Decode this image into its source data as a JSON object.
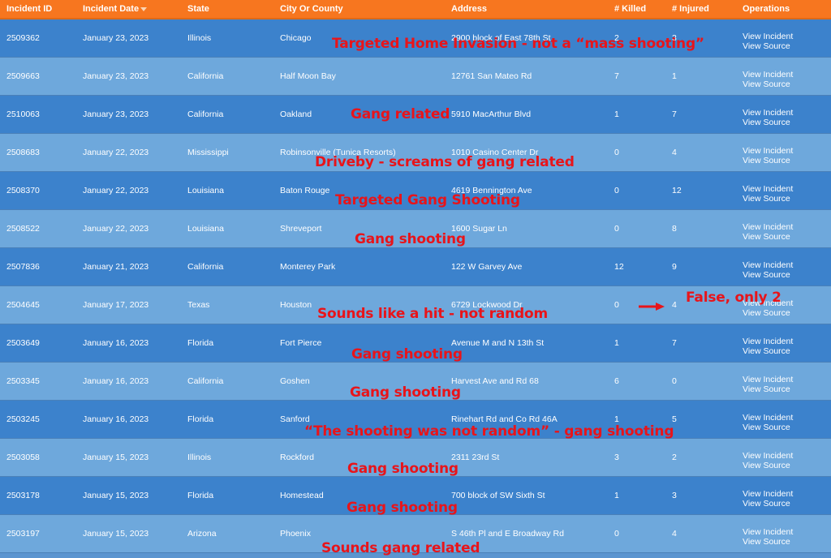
{
  "header": {
    "columns": [
      "Incident ID",
      "Incident Date",
      "State",
      "City Or County",
      "Address",
      "# Killed",
      "# Injured",
      "Operations"
    ]
  },
  "rows": [
    {
      "id": "2509362",
      "date": "January 23, 2023",
      "state": "Illinois",
      "city": "Chicago",
      "address": "2900 block of East 78th St",
      "killed": "2",
      "injured": "3",
      "view_incident": "View Incident",
      "view_source": "View Source"
    },
    {
      "id": "2509663",
      "date": "January 23, 2023",
      "state": "California",
      "city": "Half Moon Bay",
      "address": "12761 San Mateo Rd",
      "killed": "7",
      "injured": "1",
      "view_incident": "View Incident",
      "view_source": "View Source"
    },
    {
      "id": "2510063",
      "date": "January 23, 2023",
      "state": "California",
      "city": "Oakland",
      "address": "5910 MacArthur Blvd",
      "killed": "1",
      "injured": "7",
      "view_incident": "View Incident",
      "view_source": "View Source"
    },
    {
      "id": "2508683",
      "date": "January 22, 2023",
      "state": "Mississippi",
      "city": "Robinsonville (Tunica Resorts)",
      "address": "1010 Casino Center Dr",
      "killed": "0",
      "injured": "4",
      "view_incident": "View Incident",
      "view_source": "View Source"
    },
    {
      "id": "2508370",
      "date": "January 22, 2023",
      "state": "Louisiana",
      "city": "Baton Rouge",
      "address": "4619 Bennington Ave",
      "killed": "0",
      "injured": "12",
      "view_incident": "View Incident",
      "view_source": "View Source"
    },
    {
      "id": "2508522",
      "date": "January 22, 2023",
      "state": "Louisiana",
      "city": "Shreveport",
      "address": "1600 Sugar Ln",
      "killed": "0",
      "injured": "8",
      "view_incident": "View Incident",
      "view_source": "View Source"
    },
    {
      "id": "2507836",
      "date": "January 21, 2023",
      "state": "California",
      "city": "Monterey Park",
      "address": "122 W Garvey Ave",
      "killed": "12",
      "injured": "9",
      "view_incident": "View Incident",
      "view_source": "View Source"
    },
    {
      "id": "2504645",
      "date": "January 17, 2023",
      "state": "Texas",
      "city": "Houston",
      "address": "6729 Lockwood Dr",
      "killed": "0",
      "injured": "4",
      "view_incident": "View Incident",
      "view_source": "View Source"
    },
    {
      "id": "2503649",
      "date": "January 16, 2023",
      "state": "Florida",
      "city": "Fort Pierce",
      "address": "Avenue M and N 13th St",
      "killed": "1",
      "injured": "7",
      "view_incident": "View Incident",
      "view_source": "View Source"
    },
    {
      "id": "2503345",
      "date": "January 16, 2023",
      "state": "California",
      "city": "Goshen",
      "address": "Harvest Ave and Rd 68",
      "killed": "6",
      "injured": "0",
      "view_incident": "View Incident",
      "view_source": "View Source"
    },
    {
      "id": "2503245",
      "date": "January 16, 2023",
      "state": "Florida",
      "city": "Sanford",
      "address": "Rinehart Rd and Co Rd 46A",
      "killed": "1",
      "injured": "5",
      "view_incident": "View Incident",
      "view_source": "View Source"
    },
    {
      "id": "2503058",
      "date": "January 15, 2023",
      "state": "Illinois",
      "city": "Rockford",
      "address": "2311 23rd St",
      "killed": "3",
      "injured": "2",
      "view_incident": "View Incident",
      "view_source": "View Source"
    },
    {
      "id": "2503178",
      "date": "January 15, 2023",
      "state": "Florida",
      "city": "Homestead",
      "address": "700 block of SW Sixth St",
      "killed": "1",
      "injured": "3",
      "view_incident": "View Incident",
      "view_source": "View Source"
    },
    {
      "id": "2503197",
      "date": "January 15, 2023",
      "state": "Arizona",
      "city": "Phoenix",
      "address": "S 46th Pl and E Broadway Rd",
      "killed": "0",
      "injured": "4",
      "view_incident": "View Incident",
      "view_source": "View Source"
    }
  ],
  "annotations": [
    "Targeted Home Invasion - not a “mass shooting”",
    "Gang related",
    "Driveby - screams of gang related",
    "Targeted Gang Shooting",
    "Gang shooting",
    "False, only 2",
    "Sounds like a hit - not random",
    "Gang shooting",
    "Gang shooting",
    "“The shooting was not random” - gang shooting",
    "Gang shooting",
    "Gang shooting",
    "Sounds gang related"
  ],
  "colors": {
    "header": "#f7761f",
    "row_dark": "#3c82cc",
    "row_light": "#6ea8dc",
    "annotation": "#e8141a"
  }
}
